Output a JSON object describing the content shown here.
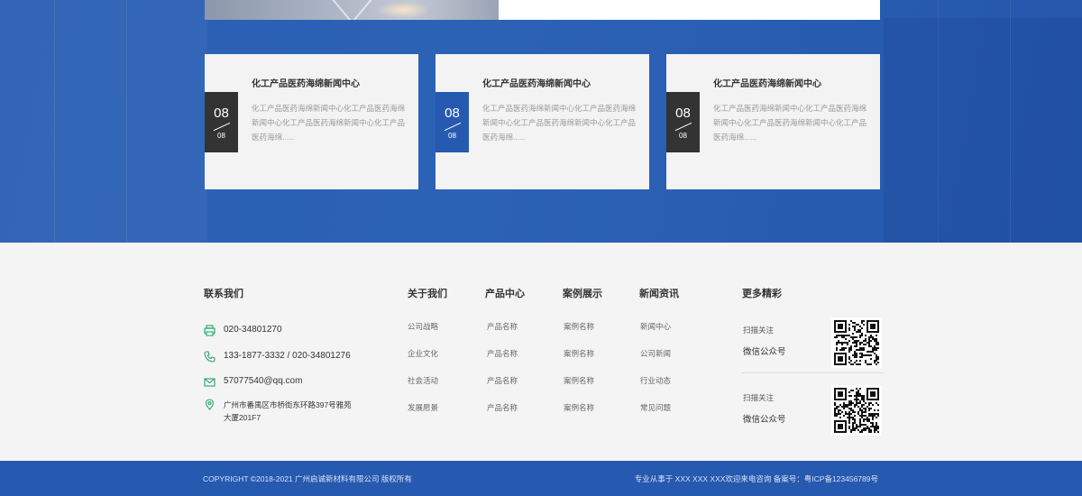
{
  "news": {
    "cards": [
      {
        "title": "化工产品医药海绵新闻中心",
        "desc": "化工产品医药海绵新闻中心化工产品医药海绵新闻中心化工产品医药海绵新闻中心化工产品医药海绵......",
        "day": "08",
        "month": "08",
        "date_color": "dark"
      },
      {
        "title": "化工产品医药海绵新闻中心",
        "desc": "化工产品医药海绵新闻中心化工产品医药海绵新闻中心化工产品医药海绵新闻中心化工产品医药海绵......",
        "day": "08",
        "month": "08",
        "date_color": "blue"
      },
      {
        "title": "化工产品医药海绵新闻中心",
        "desc": "化工产品医药海绵新闻中心化工产品医药海绵新闻中心化工产品医药海绵新闻中心化工产品医药海绵......",
        "day": "08",
        "month": "08",
        "date_color": "dark"
      }
    ]
  },
  "footer": {
    "contact": {
      "heading": "联系我们",
      "phone": "020-34801270",
      "mobile": "133-1877-3332 / 020-34801276",
      "email": "57077540@qq.com",
      "address": "广州市番禺区市桥街东环路397号雅苑大厦201F7"
    },
    "columns": [
      {
        "heading": "关于我们",
        "links": [
          "公司战略",
          "企业文化",
          "社会活动",
          "发展愿景"
        ]
      },
      {
        "heading": "产品中心",
        "links": [
          "产品名称",
          "产品名称",
          "产品名称",
          "产品名称"
        ]
      },
      {
        "heading": "案例展示",
        "links": [
          "案例名称",
          "案例名称",
          "案例名称",
          "案例名称"
        ]
      },
      {
        "heading": "新闻资讯",
        "links": [
          "新闻中心",
          "公司新闻",
          "行业动态",
          "常见问题"
        ]
      }
    ],
    "more": {
      "heading": "更多精彩",
      "qr": [
        {
          "caption": "扫描关注",
          "label": "微信公众号"
        },
        {
          "caption": "扫描关注",
          "label": "微信公众号"
        }
      ]
    }
  },
  "bottom": {
    "copyright": "COPYRIGHT ©2018-2021 广州启诚新材料有限公司 版权所有",
    "right": "专业从事于 XXX XXX XXX欢迎来电咨询 备案号：粤ICP备123456789号"
  },
  "colors": {
    "brand": "#2659b0",
    "dark": "#333333"
  },
  "icons": [
    "phone-icon",
    "mobile-icon",
    "email-icon",
    "location-icon",
    "qr-code-icon"
  ]
}
